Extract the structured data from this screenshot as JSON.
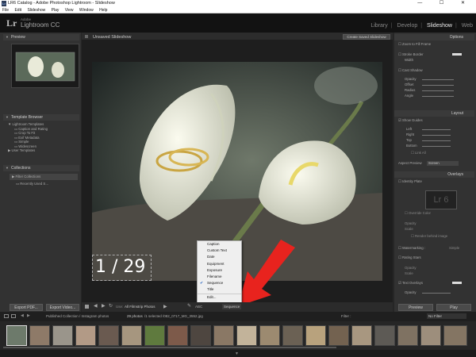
{
  "window": {
    "title": "LR6 Catalog - Adobe Photoshop Lightroom - Slideshow",
    "icon_text": "Lr",
    "controls": "— ☐ ✕"
  },
  "menubar": [
    "File",
    "Edit",
    "Slideshow",
    "Play",
    "View",
    "Window",
    "Help"
  ],
  "identity": {
    "logo": "Lr",
    "adobe": "Adobe",
    "product": "Lightroom CC"
  },
  "modules": {
    "library": "Library",
    "develop": "Develop",
    "slideshow": "Slideshow",
    "web": "Web",
    "sep": "|"
  },
  "left": {
    "preview_header": "Preview",
    "template_browser_header": "Template Browser",
    "templates_folder": "Lightroom Templates",
    "templates": [
      "Caption and Rating",
      "Crop To Fit",
      "Exif Metadata",
      "Simple",
      "Widescreen"
    ],
    "user_templates": "User Templates",
    "collections_header": "Collections",
    "collection_filter": "Filter Collections",
    "collection_item": "Recently Used S…",
    "export_pdf": "Export PDF...",
    "export_video": "Export Video..."
  },
  "center": {
    "title": "Unsaved Slideshow",
    "create_saved": "Create Saved Slideshow",
    "slide_counter": "1 / 29",
    "text_overlay_label": "ABC",
    "use_label": "Use:",
    "use_value": "All Filmstrip Photos",
    "sequence_field": "Sequence"
  },
  "context_menu": {
    "items": [
      "Caption",
      "Custom Text",
      "Date",
      "Equipment",
      "Exposure",
      "Filename",
      "Sequence",
      "Title",
      "Edit..."
    ],
    "checked": "Sequence"
  },
  "right": {
    "options_header": "Options",
    "zoom_to_fill": "Zoom to Fill Frame",
    "stroke_border": "Stroke Border",
    "width": "Width",
    "cast_shadow": "Cast Shadow",
    "opacity": "Opacity",
    "offset": "Offset",
    "radius": "Radius",
    "angle": "Angle",
    "layout_header": "Layout",
    "show_guides": "Show Guides",
    "left_label": "Left",
    "right_label": "Right",
    "top_label": "Top",
    "bottom_label": "Bottom",
    "link_all": "Link All",
    "aspect_preview": "Aspect Preview",
    "aspect_value": "Screen",
    "overlays_header": "Overlays",
    "identity_plate": "Identity Plate",
    "identity_plate_text": "Lr 6",
    "override_color": "Override Color",
    "scale": "Scale",
    "render_behind": "Render behind image",
    "watermarking": "Watermarking :",
    "watermark_value": "Simple",
    "rating_stars": "Rating Stars",
    "text_overlays": "Text Overlays",
    "preview_btn": "Preview",
    "play_btn": "Play"
  },
  "filmstrip": {
    "source": "Published Collection / Instagram photos",
    "count": "29 photos",
    "selected": "/1 selected",
    "filename": "/082_0717_MG_3552.jpg",
    "filter_label": "Filter :",
    "filter_value": "No Filter",
    "pages": [
      "1",
      "2"
    ]
  },
  "colors": {
    "arrow": "#e8231e",
    "panel": "#323232",
    "header": "#3a3a3a",
    "menu_bg": "#efefef",
    "check": "#2060c0"
  }
}
